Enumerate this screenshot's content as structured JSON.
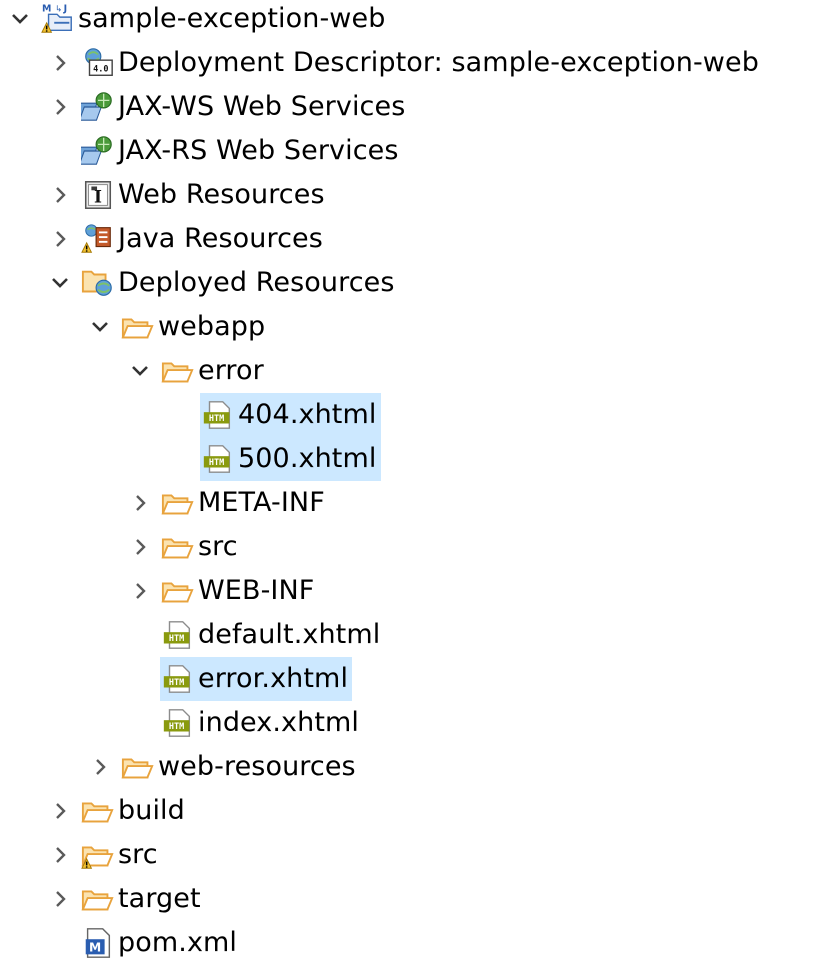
{
  "tree": {
    "items": [
      {
        "label": "sample-exception-web",
        "indent": 0,
        "expander": "expanded",
        "icon": "maven-project-warning-icon"
      },
      {
        "label": "Deployment Descriptor: sample-exception-web",
        "indent": 1,
        "expander": "collapsed",
        "icon": "deployment-descriptor-icon"
      },
      {
        "label": "JAX-WS Web Services",
        "indent": 1,
        "expander": "collapsed",
        "icon": "web-services-icon"
      },
      {
        "label": "JAX-RS Web Services",
        "indent": 1,
        "expander": "none",
        "icon": "web-services-icon"
      },
      {
        "label": "Web Resources",
        "indent": 1,
        "expander": "collapsed",
        "icon": "web-resources-icon"
      },
      {
        "label": "Java Resources",
        "indent": 1,
        "expander": "collapsed",
        "icon": "java-resources-warning-icon"
      },
      {
        "label": "Deployed Resources",
        "indent": 1,
        "expander": "expanded",
        "icon": "deployed-resources-icon"
      },
      {
        "label": "webapp",
        "indent": 2,
        "expander": "expanded",
        "icon": "folder-open-icon"
      },
      {
        "label": "error",
        "indent": 3,
        "expander": "expanded",
        "icon": "folder-open-icon"
      },
      {
        "label": "404.xhtml",
        "indent": 4,
        "expander": "none",
        "icon": "html-file-icon",
        "selected": true
      },
      {
        "label": "500.xhtml",
        "indent": 4,
        "expander": "none",
        "icon": "html-file-icon",
        "selected": true
      },
      {
        "label": "META-INF",
        "indent": 3,
        "expander": "collapsed",
        "icon": "folder-open-icon"
      },
      {
        "label": "src",
        "indent": 3,
        "expander": "collapsed",
        "icon": "folder-open-icon"
      },
      {
        "label": "WEB-INF",
        "indent": 3,
        "expander": "collapsed",
        "icon": "folder-open-icon"
      },
      {
        "label": "default.xhtml",
        "indent": 3,
        "expander": "none",
        "icon": "html-file-icon"
      },
      {
        "label": "error.xhtml",
        "indent": 3,
        "expander": "none",
        "icon": "html-file-icon",
        "selected": true
      },
      {
        "label": "index.xhtml",
        "indent": 3,
        "expander": "none",
        "icon": "html-file-icon"
      },
      {
        "label": "web-resources",
        "indent": 2,
        "expander": "collapsed",
        "icon": "folder-open-icon"
      },
      {
        "label": "build",
        "indent": 1,
        "expander": "collapsed",
        "icon": "folder-open-icon"
      },
      {
        "label": "src",
        "indent": 1,
        "expander": "collapsed",
        "icon": "folder-warning-icon"
      },
      {
        "label": "target",
        "indent": 1,
        "expander": "collapsed",
        "icon": "folder-open-icon"
      },
      {
        "label": "pom.xml",
        "indent": 1,
        "expander": "none",
        "icon": "maven-pom-icon"
      }
    ]
  },
  "colors": {
    "selection": "#cce8ff",
    "folder": "#e8a33d",
    "html_icon": "#8a9a0e",
    "chevron": "#5a5a5a"
  }
}
